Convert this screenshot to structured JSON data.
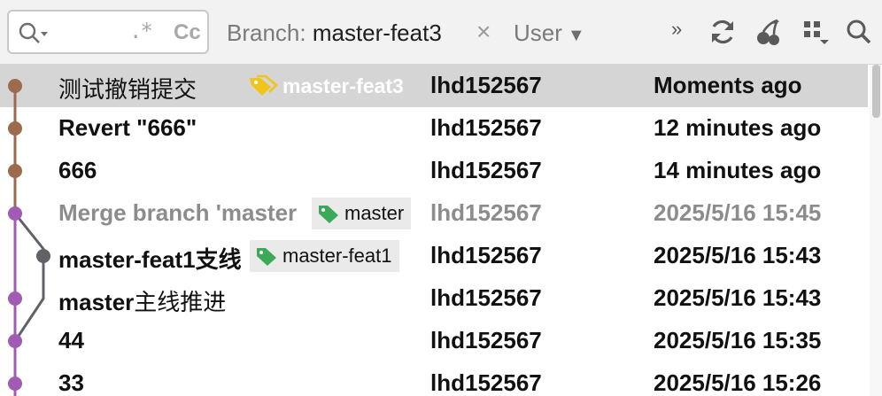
{
  "toolbar": {
    "search": {
      "value": "",
      "placeholder": "",
      "regex_label": ".*",
      "case_label": "Cc"
    },
    "branch_filter": {
      "label": "Branch: ",
      "value": "master-feat3"
    },
    "clear_label": "×",
    "user_filter": {
      "label": "User",
      "caret": "▼"
    },
    "more_label": "»",
    "icons": [
      "search-icon",
      "refresh-icon",
      "cherry-pick-icon",
      "grid-view-icon",
      "find-icon"
    ]
  },
  "commits": [
    {
      "message": "测试撤销提交",
      "tag": "master-feat3",
      "author": "lhd152567",
      "date": "Moments ago"
    },
    {
      "message": "Revert \"666\"",
      "tag": "",
      "author": "lhd152567",
      "date": "12 minutes ago"
    },
    {
      "message": "666",
      "tag": "",
      "author": "lhd152567",
      "date": "14 minutes ago"
    },
    {
      "message": "Merge branch 'master",
      "tag": "master",
      "author": "lhd152567",
      "date": "2025/5/16 15:45"
    },
    {
      "message": "master-feat1支线",
      "tag": "master-feat1",
      "author": "lhd152567",
      "date": "2025/5/16 15:43"
    },
    {
      "message_prefix": "master",
      "message_cjk": "主线推进",
      "tag": "",
      "author": "lhd152567",
      "date": "2025/5/16 15:43"
    },
    {
      "message": "44",
      "tag": "",
      "author": "lhd152567",
      "date": "2025/5/16 15:35"
    },
    {
      "message": "33",
      "tag": "",
      "author": "lhd152567",
      "date": "2025/5/16 15:26"
    }
  ],
  "colors": {
    "graph_brown": "#9c6b4e",
    "graph_purple": "#a05cb5",
    "graph_gray": "#5f6368",
    "tag_green": "#3aaa59",
    "tag_yellow": "#f0c419",
    "selection": "#d5d5d5"
  }
}
